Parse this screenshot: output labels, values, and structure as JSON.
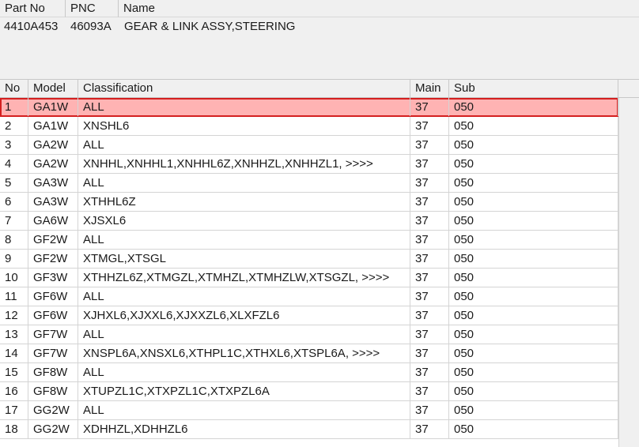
{
  "info": {
    "headers": {
      "part_no": "Part No",
      "pnc": "PNC",
      "name": "Name"
    },
    "values": {
      "part_no": "4410A453",
      "pnc": "46093A",
      "name": "GEAR & LINK ASSY,STEERING"
    }
  },
  "table": {
    "headers": {
      "no": "No",
      "model": "Model",
      "classification": "Classification",
      "main": "Main",
      "sub": "Sub"
    },
    "rows": [
      {
        "no": "1",
        "model": "GA1W",
        "classification": "ALL",
        "main": "37",
        "sub": "050"
      },
      {
        "no": "2",
        "model": "GA1W",
        "classification": "XNSHL6",
        "main": "37",
        "sub": "050"
      },
      {
        "no": "3",
        "model": "GA2W",
        "classification": "ALL",
        "main": "37",
        "sub": "050"
      },
      {
        "no": "4",
        "model": "GA2W",
        "classification": "XNHHL,XNHHL1,XNHHL6Z,XNHHZL,XNHHZL1,  >>>>",
        "main": "37",
        "sub": "050"
      },
      {
        "no": "5",
        "model": "GA3W",
        "classification": "ALL",
        "main": "37",
        "sub": "050"
      },
      {
        "no": "6",
        "model": "GA3W",
        "classification": "XTHHL6Z",
        "main": "37",
        "sub": "050"
      },
      {
        "no": "7",
        "model": "GA6W",
        "classification": "XJSXL6",
        "main": "37",
        "sub": "050"
      },
      {
        "no": "8",
        "model": "GF2W",
        "classification": "ALL",
        "main": "37",
        "sub": "050"
      },
      {
        "no": "9",
        "model": "GF2W",
        "classification": "XTMGL,XTSGL",
        "main": "37",
        "sub": "050"
      },
      {
        "no": "10",
        "model": "GF3W",
        "classification": "XTHHZL6Z,XTMGZL,XTMHZL,XTMHZLW,XTSGZL,  >>>>",
        "main": "37",
        "sub": "050"
      },
      {
        "no": "11",
        "model": "GF6W",
        "classification": "ALL",
        "main": "37",
        "sub": "050"
      },
      {
        "no": "12",
        "model": "GF6W",
        "classification": "XJHXL6,XJXXL6,XJXXZL6,XLXFZL6",
        "main": "37",
        "sub": "050"
      },
      {
        "no": "13",
        "model": "GF7W",
        "classification": "ALL",
        "main": "37",
        "sub": "050"
      },
      {
        "no": "14",
        "model": "GF7W",
        "classification": "XNSPL6A,XNSXL6,XTHPL1C,XTHXL6,XTSPL6A,  >>>>",
        "main": "37",
        "sub": "050"
      },
      {
        "no": "15",
        "model": "GF8W",
        "classification": "ALL",
        "main": "37",
        "sub": "050"
      },
      {
        "no": "16",
        "model": "GF8W",
        "classification": "XTUPZL1C,XTXPZL1C,XTXPZL6A",
        "main": "37",
        "sub": "050"
      },
      {
        "no": "17",
        "model": "GG2W",
        "classification": "ALL",
        "main": "37",
        "sub": "050"
      },
      {
        "no": "18",
        "model": "GG2W",
        "classification": "XDHHZL,XDHHZL6",
        "main": "37",
        "sub": "050"
      }
    ],
    "selected_row": "1"
  },
  "colors": {
    "selected_fill": "#ffb3b3",
    "selected_border": "#d42020",
    "panel_bg": "#f0f0f0"
  }
}
